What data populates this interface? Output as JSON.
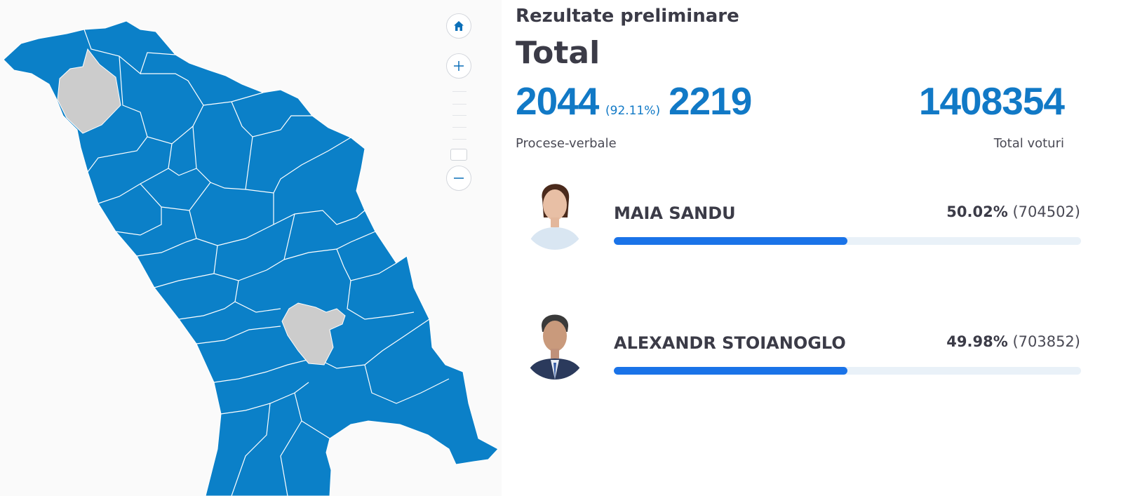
{
  "header": {
    "subtitle": "Rezultate preliminare",
    "title": "Total"
  },
  "stats": {
    "processed_reports": "2044",
    "processed_percent": "(92.11%)",
    "total_reports": "2219",
    "reports_label": "Procese-verbale",
    "total_votes": "1408354",
    "votes_label": "Total voturi"
  },
  "candidates": [
    {
      "name": "MAIA SANDU",
      "percent": "50.02%",
      "votes": "(704502)",
      "share": 0.5002
    },
    {
      "name": "ALEXANDR STOIANOGLO",
      "percent": "49.98%",
      "votes": "(703852)",
      "share": 0.4998
    }
  ],
  "map": {
    "controls": [
      "home-icon",
      "plus-icon",
      "minus-icon"
    ],
    "colors": {
      "region_fill": "#0b80c8",
      "region_no_data": "#cccccc",
      "region_border": "#ffffff",
      "bar_fill": "#1a73e8",
      "bar_track": "#e9f1f8",
      "accent_text": "#1179c6"
    }
  }
}
